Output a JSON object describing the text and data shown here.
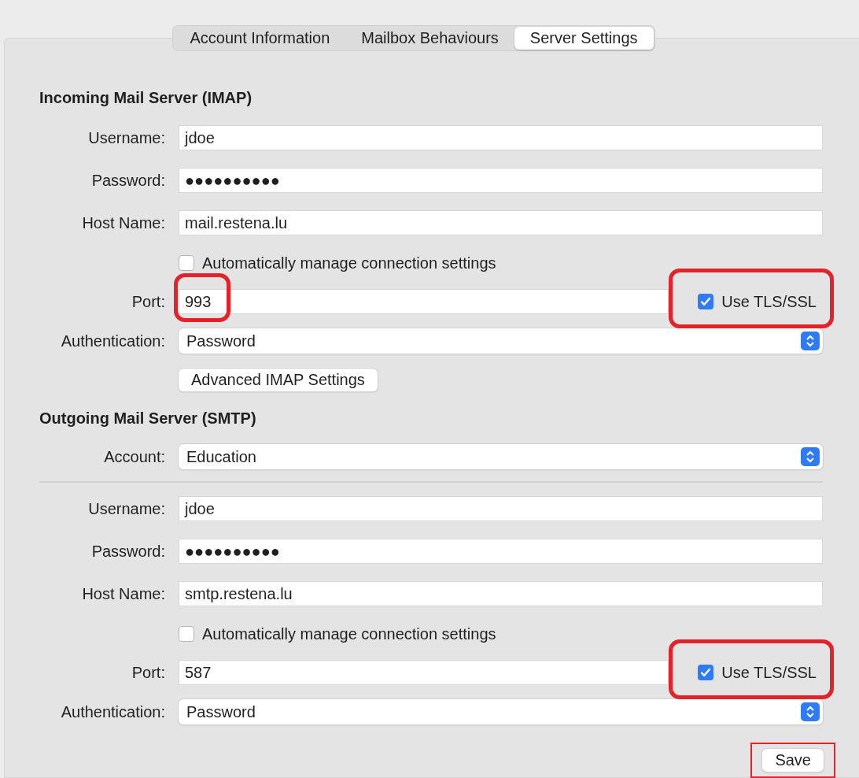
{
  "tabs": [
    {
      "label": "Account Information",
      "selected": false
    },
    {
      "label": "Mailbox Behaviours",
      "selected": false
    },
    {
      "label": "Server Settings",
      "selected": true
    }
  ],
  "sections": [
    {
      "title": "Incoming Mail Server (IMAP)",
      "rows": [
        {
          "kind": "text",
          "label": "Username:",
          "value": "jdoe"
        },
        {
          "kind": "text",
          "label": "Password:",
          "value": "●●●●●●●●●●"
        },
        {
          "kind": "text",
          "label": "Host Name:",
          "value": "mail.restena.lu"
        },
        {
          "kind": "checkbox",
          "label": "Automatically manage connection settings",
          "checked": false
        },
        {
          "kind": "port",
          "label": "Port:",
          "value": "993",
          "highlighted": true,
          "tls": {
            "label": "Use TLS/SSL",
            "checked": true,
            "highlighted": true
          }
        },
        {
          "kind": "select",
          "label": "Authentication:",
          "value": "Password"
        },
        {
          "kind": "button",
          "label": "Advanced IMAP Settings"
        }
      ]
    },
    {
      "title": "Outgoing Mail Server (SMTP)",
      "rows": [
        {
          "kind": "select",
          "label": "Account:",
          "value": "Education"
        },
        {
          "kind": "divider"
        },
        {
          "kind": "text",
          "label": "Username:",
          "value": "jdoe"
        },
        {
          "kind": "text",
          "label": "Password:",
          "value": "●●●●●●●●●●"
        },
        {
          "kind": "text",
          "label": "Host Name:",
          "value": "smtp.restena.lu"
        },
        {
          "kind": "checkbox",
          "label": "Automatically manage connection settings",
          "checked": false
        },
        {
          "kind": "port",
          "label": "Port:",
          "value": "587",
          "highlighted": false,
          "tls": {
            "label": "Use TLS/SSL",
            "checked": true,
            "highlighted": true
          }
        },
        {
          "kind": "select",
          "label": "Authentication:",
          "value": "Password"
        }
      ]
    }
  ],
  "save": {
    "label": "Save",
    "highlighted": true
  }
}
